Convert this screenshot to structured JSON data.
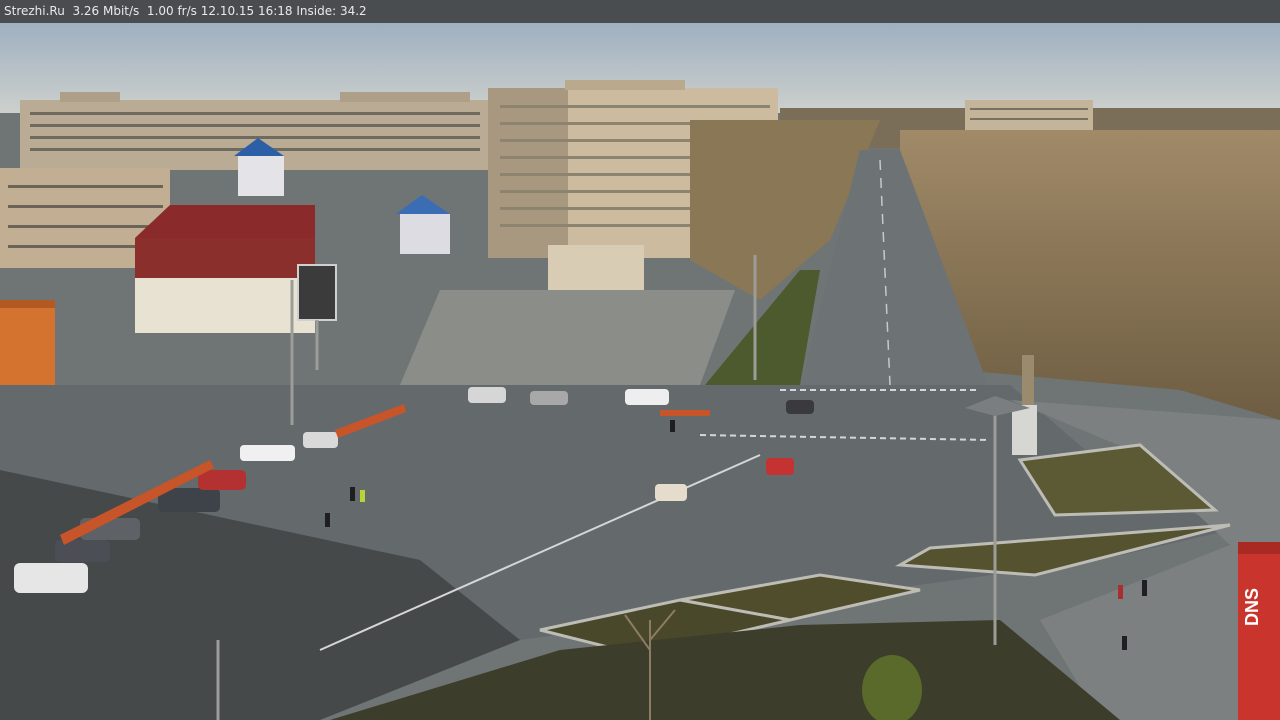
{
  "overlay": {
    "text": "Strezhi.Ru  3.26 Mbit/s  1.00 fr/s 12.10.15 16:18 Inside: 34.2"
  },
  "signage": {
    "store_sign": "DNS"
  },
  "colors": {
    "sky_top": "#9fb0c0",
    "sky_bottom": "#c9cdcc",
    "asphalt": "#626769",
    "shadow": "#3e4142",
    "grass": "#4b4a2a",
    "trees": "#8f7a5a",
    "building_panel": "#c9b79c",
    "red_roof": "#8a2a2a",
    "blue_roof": "#2d5fa6"
  }
}
